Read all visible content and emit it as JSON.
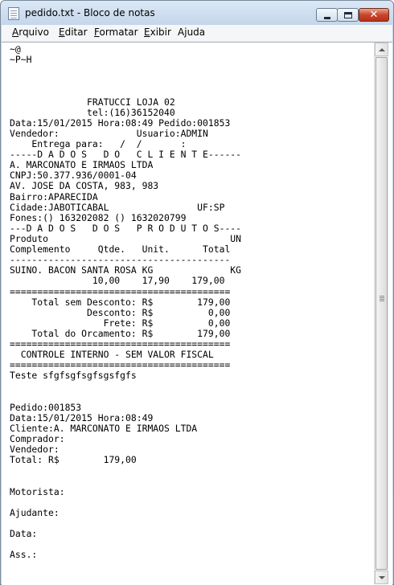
{
  "window": {
    "title": "pedido.txt - Bloco de notas",
    "controls": {
      "minimize_icon": "minimize-icon",
      "maximize_icon": "maximize-icon",
      "close_icon": "close-icon"
    }
  },
  "menu": {
    "items": [
      {
        "label": "Arquivo",
        "accel": "A",
        "rest": "rquivo"
      },
      {
        "label": "Editar",
        "accel": "E",
        "rest": "ditar"
      },
      {
        "label": "Formatar",
        "accel": "F",
        "rest": "ormatar"
      },
      {
        "label": "Exibir",
        "accel": "E",
        "rest": "xibir"
      },
      {
        "label": "Ajuda",
        "accel": "j",
        "pre": "A",
        "rest": "uda"
      }
    ]
  },
  "document": {
    "lines": [
      "~@",
      "~P~H",
      "",
      "",
      "",
      "              FRATUCCI LOJA 02",
      "              tel:(16)36152040",
      "Data:15/01/2015 Hora:08:49 Pedido:001853",
      "Vendedor:              Usuario:ADMIN",
      "    Entrega para:   /  /       :",
      "-----D A D O S   D O   C L I E N T E------",
      "A. MARCONATO E IRMAOS LTDA",
      "CNPJ:50.377.936/0001-04",
      "AV. JOSE DA COSTA, 983, 983",
      "Bairro:APARECIDA",
      "Cidade:JABOTICABAL                UF:SP",
      "Fones:() 163202082 () 1632020799",
      "---D A D O S   D O S   P R O D U T O S----",
      "Produto                                 UN",
      "Complemento     Qtde.   Unit.      Total",
      "----------------------------------------",
      "SUINO. BACON SANTA ROSA KG              KG",
      "               10,00    17,90    179,00",
      "========================================",
      "    Total sem Desconto: R$        179,00",
      "              Desconto: R$          0,00",
      "                 Frete: R$          0,00",
      "    Total do Orcamento: R$        179,00",
      "========================================",
      "  CONTROLE INTERNO - SEM VALOR FISCAL",
      "========================================",
      "Teste sfgfsgfsgfsgsfgfs",
      "",
      "",
      "Pedido:001853",
      "Data:15/01/2015 Hora:08:49",
      "Cliente:A. MARCONATO E IRMAOS LTDA",
      "Comprador:",
      "Vendedor:",
      "Total: R$        179,00",
      "",
      "",
      "Motorista:",
      "",
      "Ajudante:",
      "",
      "Data:",
      "",
      "Ass.:",
      ""
    ]
  },
  "scrollbar": {
    "up_icon": "scroll-up-arrow-icon",
    "down_icon": "scroll-down-arrow-icon"
  }
}
